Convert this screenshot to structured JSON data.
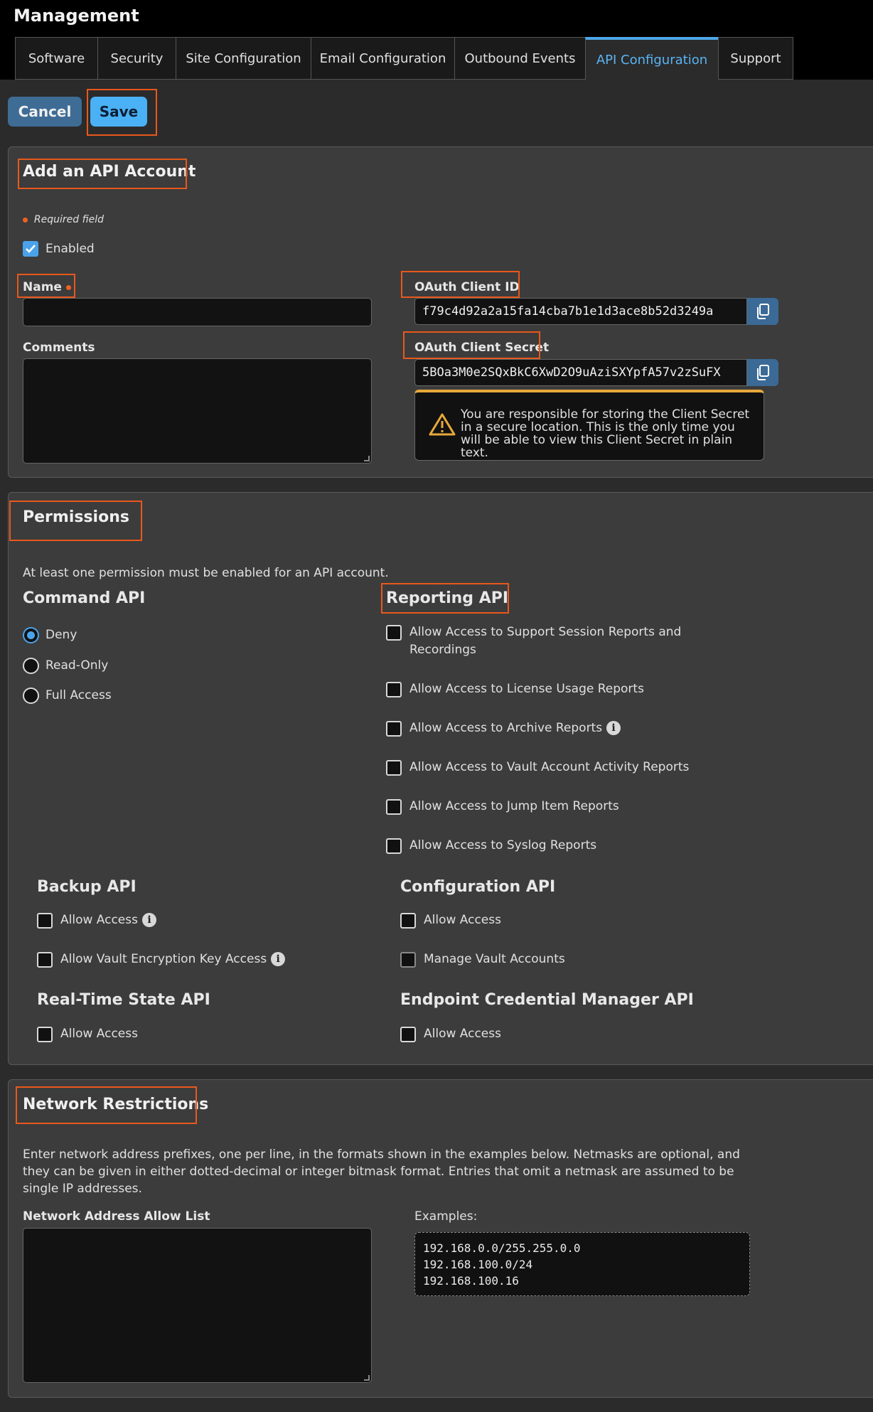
{
  "page_title": "Management",
  "tabs": [
    {
      "label": "Software"
    },
    {
      "label": "Security"
    },
    {
      "label": "Site Configuration"
    },
    {
      "label": "Email Configuration"
    },
    {
      "label": "Outbound Events"
    },
    {
      "label": "API Configuration"
    },
    {
      "label": "Support"
    }
  ],
  "active_tab": "API Configuration",
  "actions": {
    "cancel": "Cancel",
    "save": "Save"
  },
  "account": {
    "title": "Add an API Account",
    "required_note": "Required field",
    "enabled_label": "Enabled",
    "enabled": true,
    "name_label": "Name",
    "name_value": "",
    "comments_label": "Comments",
    "comments_value": "",
    "client_id_label": "OAuth Client ID",
    "client_id": "f79c4d92a2a15fa14cba7b1e1d3ace8b52d3249a",
    "client_secret_label": "OAuth Client Secret",
    "client_secret": "5BOa3M0e2SQxBkC6XwD2O9uAziSXYpfA57v2zSuFX",
    "warning": "You are responsible for storing the Client Secret in a secure location. This is the only time you will be able to view this Client Secret in plain text."
  },
  "permissions": {
    "title": "Permissions",
    "note": "At least one permission must be enabled for an API account.",
    "command_api": {
      "title": "Command API",
      "options": [
        "Deny",
        "Read-Only",
        "Full Access"
      ],
      "selected": "Deny"
    },
    "reporting_api": {
      "title": "Reporting API",
      "items": [
        "Allow Access to Support Session Reports and Recordings",
        "Allow Access to License Usage Reports",
        "Allow Access to Archive Reports",
        "Allow Access to Vault Account Activity Reports",
        "Allow Access to Jump Item Reports",
        "Allow Access to Syslog Reports"
      ]
    },
    "backup_api": {
      "title": "Backup API",
      "items": [
        "Allow Access",
        "Allow Vault Encryption Key Access"
      ]
    },
    "configuration_api": {
      "title": "Configuration API",
      "items": [
        "Allow Access",
        "Manage Vault Accounts"
      ]
    },
    "realtime_api": {
      "title": "Real-Time State API",
      "items": [
        "Allow Access"
      ]
    },
    "ecm_api": {
      "title": "Endpoint Credential Manager API",
      "items": [
        "Allow Access"
      ]
    }
  },
  "network": {
    "title": "Network Restrictions",
    "description": "Enter network address prefixes, one per line, in the formats shown in the examples below. Netmasks are optional, and they can be given in either dotted-decimal or integer bitmask format. Entries that omit a netmask are assumed to be single IP addresses.",
    "allow_list_label": "Network Address Allow List",
    "allow_list_value": "",
    "examples_label": "Examples:",
    "examples": [
      "192.168.0.0/255.255.0.0",
      "192.168.100.0/24",
      "192.168.100.16"
    ]
  },
  "icons": {
    "copy": "copy-icon",
    "warning": "warning-triangle-icon",
    "info": "info-icon"
  }
}
